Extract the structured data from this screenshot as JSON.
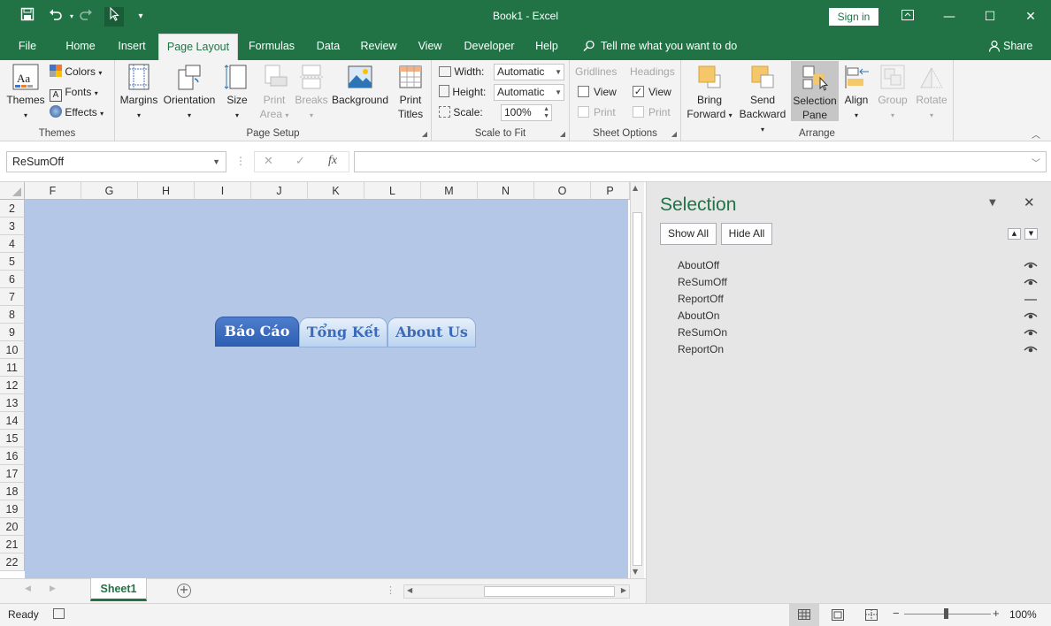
{
  "window": {
    "title": "Book1  -  Excel",
    "sign_in": "Sign in",
    "minimize": "—",
    "maximize": "☐",
    "close": "✕"
  },
  "qat": {
    "save": "save-icon",
    "undo": "undo-icon",
    "redo": "redo-icon",
    "select": "select-objects-icon",
    "customize": "▾"
  },
  "menu": {
    "tabs": [
      "File",
      "Home",
      "Insert",
      "Page Layout",
      "Formulas",
      "Data",
      "Review",
      "View",
      "Developer",
      "Help"
    ],
    "active": "Page Layout",
    "tell_me": "Tell me what you want to do",
    "share": "Share"
  },
  "ribbon": {
    "themes": {
      "themes": "Themes",
      "colors": "Colors",
      "fonts": "Fonts",
      "effects": "Effects",
      "group": "Themes"
    },
    "page_setup": {
      "margins": "Margins",
      "orientation": "Orientation",
      "size": "Size",
      "print_area_1": "Print",
      "print_area_2": "Area",
      "breaks": "Breaks",
      "background": "Background",
      "print_titles_1": "Print",
      "print_titles_2": "Titles",
      "group": "Page Setup"
    },
    "scale": {
      "width_label": "Width:",
      "width_value": "Automatic",
      "height_label": "Height:",
      "height_value": "Automatic",
      "scale_label": "Scale:",
      "scale_value": "100%",
      "group": "Scale to Fit"
    },
    "sheet_options": {
      "gridlines": "Gridlines",
      "headings": "Headings",
      "view": "View",
      "print": "Print",
      "group": "Sheet Options",
      "gridlines_view_checked": false,
      "headings_view_checked": true
    },
    "arrange": {
      "bring_1": "Bring",
      "bring_2": "Forward",
      "send_1": "Send",
      "send_2": "Backward",
      "selection_1": "Selection",
      "selection_2": "Pane",
      "align": "Align",
      "group_btn": "Group",
      "rotate": "Rotate",
      "group": "Arrange"
    }
  },
  "formula_bar": {
    "name_box": "ReSumOff",
    "fx": "fx",
    "cancel": "✕",
    "enter": "✓",
    "value": ""
  },
  "grid": {
    "columns": [
      "F",
      "G",
      "H",
      "I",
      "J",
      "K",
      "L",
      "M",
      "N",
      "O",
      "P"
    ],
    "rows": [
      "2",
      "3",
      "4",
      "5",
      "6",
      "7",
      "8",
      "9",
      "10",
      "11",
      "12",
      "13",
      "14",
      "15",
      "16",
      "17",
      "18",
      "19",
      "20",
      "21",
      "22"
    ],
    "shape_color": "#b4c7e7"
  },
  "nav_tabs": [
    {
      "label": "Báo Cáo",
      "active": true
    },
    {
      "label": "Tổng Kết",
      "active": false
    },
    {
      "label": "About Us",
      "active": false
    }
  ],
  "sheet_tabs": {
    "tabs": [
      "Sheet1"
    ],
    "add": "+"
  },
  "selection_pane": {
    "title": "Selection",
    "show_all": "Show All",
    "hide_all": "Hide All",
    "items": [
      {
        "name": "AboutOff",
        "visible": true
      },
      {
        "name": "ReSumOff",
        "visible": true
      },
      {
        "name": "ReportOff",
        "visible": false
      },
      {
        "name": "AboutOn",
        "visible": true
      },
      {
        "name": "ReSumOn",
        "visible": true
      },
      {
        "name": "ReportOn",
        "visible": true
      }
    ]
  },
  "status": {
    "ready": "Ready",
    "zoom": "100%"
  },
  "colors": {
    "accent": "#217346",
    "ribbon_bg": "#f3f3f3"
  }
}
